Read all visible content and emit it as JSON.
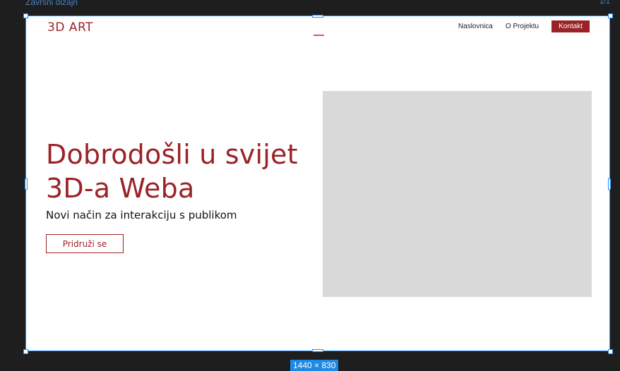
{
  "editor": {
    "frame_name": "Završni dizajn",
    "frame_size": "1440 × 830",
    "top_right_text": "1/1"
  },
  "site": {
    "logo": "3D ART",
    "nav": {
      "home": "Naslovnica",
      "about": "O Projektu",
      "contact": "Kontakt"
    },
    "hero": {
      "title_line1": "Dobrodošli u svijet",
      "title_line2": "3D-a Weba",
      "subtitle": "Novi način za interakciju s publikom",
      "cta": "Pridruži se"
    }
  },
  "colors": {
    "brand": "#9b2226",
    "selection": "#1e90ff",
    "placeholder": "#d9d9d9",
    "canvas_bg": "#1e1e1e"
  }
}
